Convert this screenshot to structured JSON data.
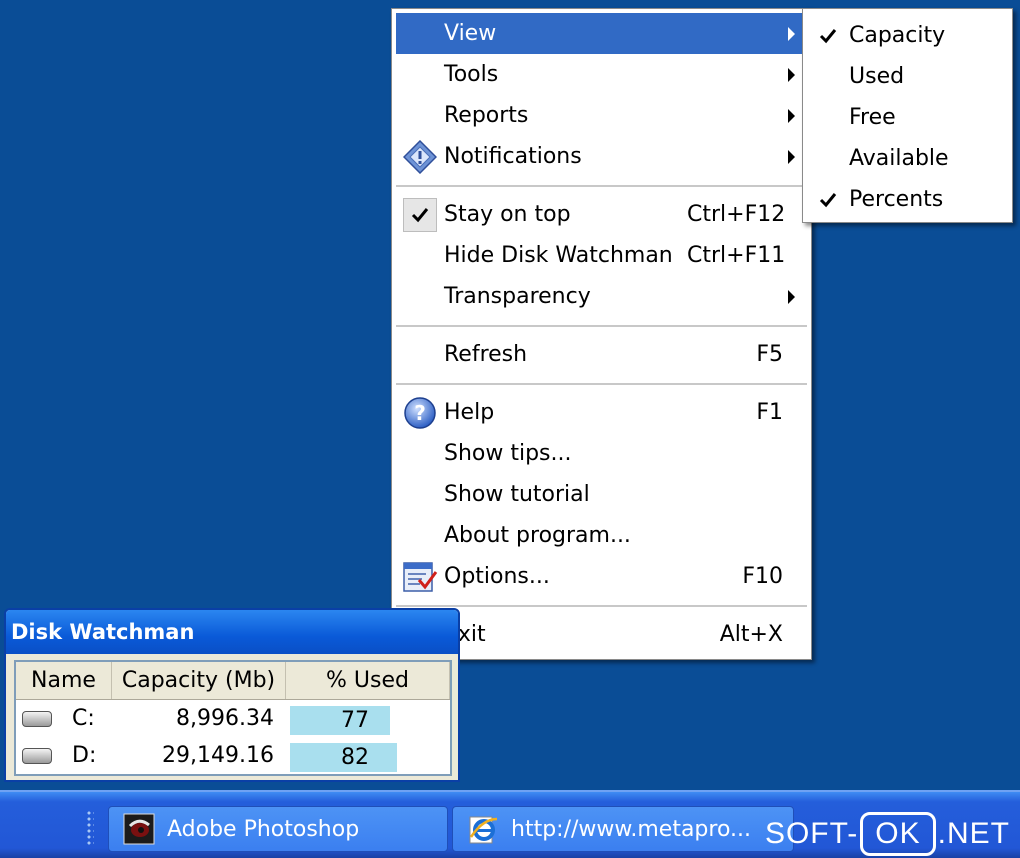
{
  "colors": {
    "desktop": "#0a4d96",
    "highlight": "#316ac5",
    "bar_fill": "#a9dfee"
  },
  "menu": {
    "items": [
      {
        "label": "View",
        "shortcut": "",
        "submenu": true
      },
      {
        "label": "Tools",
        "shortcut": "",
        "submenu": true
      },
      {
        "label": "Reports",
        "shortcut": "",
        "submenu": true
      },
      {
        "label": "Notifications",
        "shortcut": "",
        "submenu": true,
        "icon": "notification-diamond-icon"
      },
      {
        "label": "Stay on top",
        "shortcut": "Ctrl+F12",
        "checked": true
      },
      {
        "label": "Hide Disk Watchman",
        "shortcut": "Ctrl+F11"
      },
      {
        "label": "Transparency",
        "shortcut": "",
        "submenu": true
      },
      {
        "label": "Refresh",
        "shortcut": "F5"
      },
      {
        "label": "Help",
        "shortcut": "F1",
        "icon": "help-icon"
      },
      {
        "label": "Show tips...",
        "shortcut": ""
      },
      {
        "label": "Show tutorial",
        "shortcut": ""
      },
      {
        "label": "About program...",
        "shortcut": ""
      },
      {
        "label": "Options...",
        "shortcut": "F10",
        "icon": "options-icon"
      },
      {
        "label": "Exit",
        "shortcut": "Alt+X"
      }
    ]
  },
  "submenu": {
    "items": [
      {
        "label": "Capacity",
        "checked": true
      },
      {
        "label": "Used",
        "checked": false
      },
      {
        "label": "Free",
        "checked": false
      },
      {
        "label": "Available",
        "checked": false
      },
      {
        "label": "Percents",
        "checked": true
      }
    ]
  },
  "disk_watchman": {
    "title": "Disk Watchman",
    "columns": [
      "Name",
      "Capacity (Mb)",
      "% Used"
    ],
    "rows": [
      {
        "name": "C:",
        "capacity": "8,996.34",
        "used_text": "77",
        "used_fraction": 0.77
      },
      {
        "name": "D:",
        "capacity": "29,149.16",
        "used_text": "82",
        "used_fraction": 0.82
      }
    ]
  },
  "taskbar": {
    "buttons": [
      {
        "label": "Adobe Photoshop",
        "icon": "photoshop-icon"
      },
      {
        "label": "http://www.metapro...",
        "icon": "internet-explorer-icon"
      }
    ]
  },
  "watermark": {
    "left": "SOFT-",
    "box": "OK",
    "right": ".NET"
  }
}
